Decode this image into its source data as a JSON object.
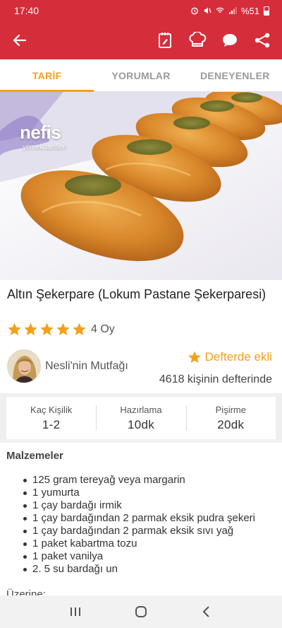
{
  "status_bar": {
    "time": "17:40",
    "battery": "%51"
  },
  "app_bar": {
    "back_icon": "arrow-left-icon",
    "actions": [
      "notebook-icon",
      "chef-hat-icon",
      "comment-icon",
      "share-icon"
    ]
  },
  "tabs": [
    {
      "label": "TARİF",
      "active": true
    },
    {
      "label": "YORUMLAR",
      "active": false
    },
    {
      "label": "DENEYENLER",
      "active": false
    }
  ],
  "hero": {
    "logo": "nefis",
    "logo_sub": "yemek tarifleri"
  },
  "recipe": {
    "title": "Altın Şekerpare (Lokum Pastane Şekerparesi)",
    "rating_stars": 5,
    "rating_count": "4 Oy"
  },
  "author": {
    "name": "Nesli'nin Mutfağı",
    "saved_label": "Defterde ekli",
    "saved_count": "4618 kişinin defterinde"
  },
  "info": [
    {
      "label": "Kaç Kişilik",
      "value": "1-2"
    },
    {
      "label": "Hazırlama",
      "value": "10dk"
    },
    {
      "label": "Pişirme",
      "value": "20dk"
    }
  ],
  "ingredients": {
    "title": "Malzemeler",
    "items": [
      "125 gram tereyağ veya margarin",
      "1 yumurta",
      "1 çay bardağı irmik",
      "1 çay bardağından 2 parmak eksik pudra şekeri",
      "1 çay bardağından 2 parmak eksik sıvı yağ",
      "1 paket kabartma tozu",
      "1 paket vanilya",
      "2. 5 su bardağı un"
    ],
    "next_section": "Üzerine:"
  },
  "colors": {
    "brand_red": "#d62d3a",
    "accent_orange": "#f3a01c"
  }
}
